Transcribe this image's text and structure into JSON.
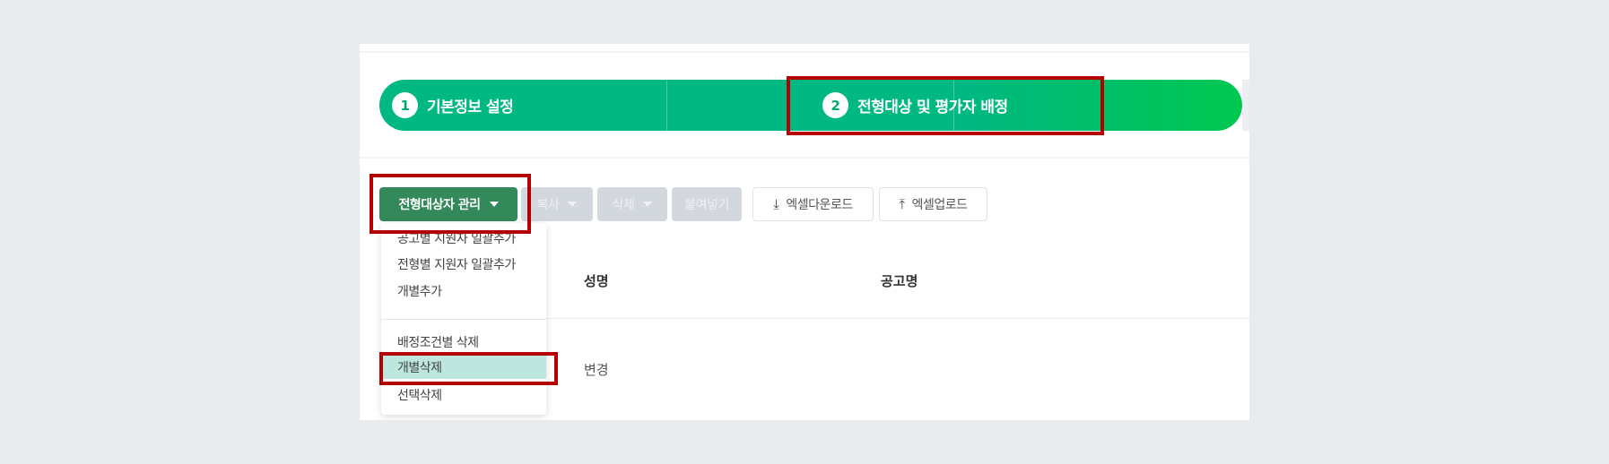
{
  "steps": [
    {
      "num": "1",
      "label": "기본정보 설정"
    },
    {
      "num": "2",
      "label": "전형대상 및 평가자 배정"
    }
  ],
  "toolbar": {
    "manage_label": "전형대상자 관리",
    "copy_label": "복사",
    "delete_label": "삭제",
    "paste_label": "붙여넣기",
    "excel_download_label": "엑셀다운로드",
    "excel_upload_label": "엑셀업로드"
  },
  "dropdown": {
    "items": [
      {
        "label": "공고별 지원자 일괄추가"
      },
      {
        "label": "전형별 지원자 일괄추가"
      },
      {
        "label": "개별추가"
      },
      {
        "label": "배정조건별 삭제"
      },
      {
        "label": "개별삭제",
        "selected": true
      },
      {
        "label": "선택삭제"
      }
    ]
  },
  "table": {
    "headers": [
      "성명",
      "공고명"
    ],
    "rows": [
      [
        "변경",
        ""
      ]
    ]
  },
  "colors": {
    "step_bar": "#00b881",
    "step_bar_end": "#00c850",
    "manage_button": "#34895b",
    "highlight": "#b40000",
    "selected_item": "#bde6df"
  },
  "icons": {
    "download": "download-icon",
    "upload": "upload-icon",
    "caret": "chevron-down-icon"
  }
}
